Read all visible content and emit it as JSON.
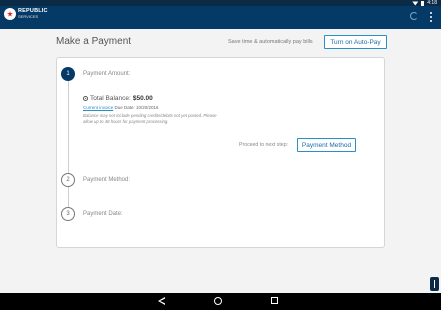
{
  "status_bar": {
    "time": "4:18"
  },
  "app_bar": {
    "logo_line1": "REPUBLIC",
    "logo_line2": "SERVICES"
  },
  "page": {
    "title": "Make a Payment",
    "autopay_text": "Save time & automatically pay bills",
    "autopay_button": "Turn on Auto-Pay"
  },
  "steps": [
    {
      "number": "1",
      "label": "Payment Amount:",
      "active": true
    },
    {
      "number": "2",
      "label": "Payment Method:",
      "active": false
    },
    {
      "number": "3",
      "label": "Payment Date:",
      "active": false
    }
  ],
  "amount": {
    "balance_label": "Total Balance:",
    "balance_value": "$50.00",
    "invoice_link": "Current invoice",
    "due_text": "Due Date: 10/20/2016",
    "note": "Balance may not include pending credits/debits not yet posted. Please allow up to 48 hours for payment processing.",
    "proceed_text": "Proceed to next step:",
    "method_button": "Payment Method"
  },
  "colors": {
    "appbar": "#063a66",
    "accent": "#2a8fc4"
  }
}
